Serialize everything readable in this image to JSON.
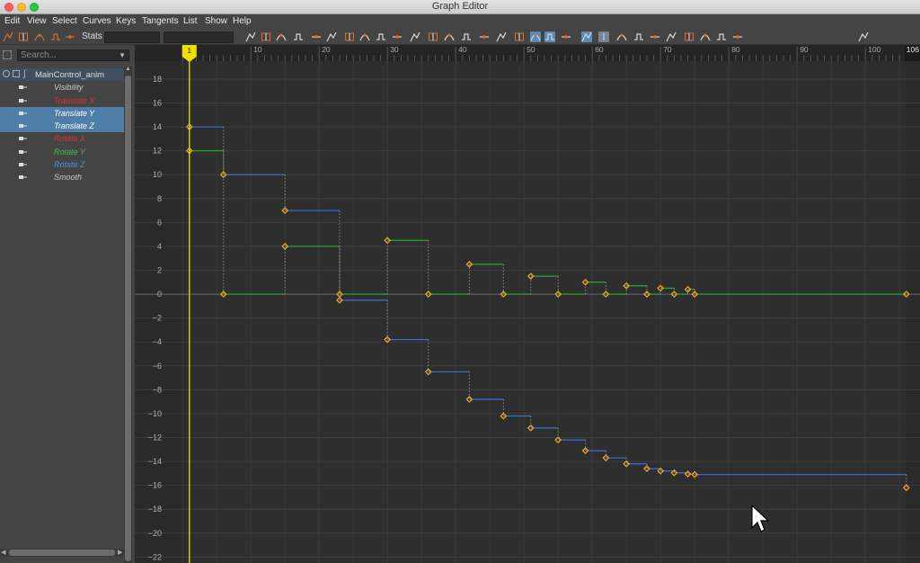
{
  "window": {
    "title": "Graph Editor"
  },
  "menu": [
    "Edit",
    "View",
    "Select",
    "Curves",
    "Keys",
    "Tangents",
    "List",
    "Show",
    "Help"
  ],
  "toolbar": {
    "stats_label": "Stats",
    "icons": [
      "move-key-icon",
      "insert-key-icon",
      "lattice-icon",
      "region-icon",
      "retime-icon",
      "frame-all-icon",
      "frame-selection-icon",
      "frame-playback-icon",
      "auto-tangent-icon",
      "spline-tangent-icon",
      "clamped-tangent-icon",
      "linear-tangent-icon",
      "flat-tangent-icon",
      "step-tangent-icon",
      "step-next-icon",
      "plateau-tangent-icon",
      "buffer-curve-snapshot-icon",
      "swap-buffer-icon",
      "break-tangents-icon",
      "unify-tangents-icon",
      "free-tangent-weight-icon",
      "lock-tangent-weight-icon",
      "isolate-curve-icon",
      "normalize-icon",
      "denormalize-icon",
      "stacked-view-icon",
      "absolute-view-icon",
      "infinity-icon",
      "pre-infinity-cycle-icon",
      "post-infinity-cycle-icon",
      "cycle-offset-icon",
      "oscillate-icon",
      "key-tick-icon",
      "dope-sheet-icon",
      "time-editor-icon",
      "trax-editor-icon"
    ]
  },
  "outliner": {
    "search_placeholder": "Search...",
    "root_label": "MainControl_anim",
    "attributes": [
      {
        "label": "Visibility",
        "color": "#c8c8c8",
        "selected": false
      },
      {
        "label": "Translate X",
        "color": "#e03030",
        "selected": false
      },
      {
        "label": "Translate Y",
        "color": "#ffffff",
        "selected": true
      },
      {
        "label": "Translate Z",
        "color": "#ffffff",
        "selected": true
      },
      {
        "label": "Rotate X",
        "color": "#e03030",
        "selected": false
      },
      {
        "label": "Rotate Y",
        "color": "#39c04a",
        "selected": false
      },
      {
        "label": "Rotate Z",
        "color": "#4a90e0",
        "selected": false
      },
      {
        "label": "Smooth",
        "color": "#c8c8c8",
        "selected": false
      }
    ]
  },
  "timeline": {
    "frame_labels": [
      "10",
      "20",
      "30",
      "40",
      "50",
      "60",
      "70",
      "80",
      "90",
      "100"
    ],
    "current_frame": "1",
    "end_frame": "106"
  },
  "colors": {
    "green_curve": "#1fae2d",
    "blue_curve": "#3a6fd8",
    "key": "#f0a020",
    "current_time": "#f0e000"
  },
  "chart_data": {
    "type": "line",
    "title": "",
    "xlabel": "",
    "ylabel": "",
    "xlim": [
      -7,
      108
    ],
    "ylim": [
      -22.5,
      19.5
    ],
    "y_ticks": [
      18,
      16,
      14,
      12,
      10,
      8,
      6,
      4,
      2,
      0,
      -2,
      -4,
      -6,
      -8,
      -10,
      -12,
      -14,
      -16,
      -18,
      -20,
      -22
    ],
    "x_ticks": [
      10,
      20,
      30,
      40,
      50,
      60,
      70,
      80,
      90,
      100
    ],
    "current_frame": 1,
    "step_tangents": true,
    "series": [
      {
        "color": "#1fae2d",
        "keys": [
          [
            1,
            12
          ],
          [
            6,
            0
          ],
          [
            15,
            4
          ],
          [
            23,
            0
          ],
          [
            30,
            4.5
          ],
          [
            36,
            0
          ],
          [
            42,
            2.5
          ],
          [
            47,
            0
          ],
          [
            51,
            1.5
          ],
          [
            55,
            0
          ],
          [
            59,
            1
          ],
          [
            62,
            0
          ],
          [
            65,
            0.7
          ],
          [
            68,
            0
          ],
          [
            70,
            0.5
          ],
          [
            72,
            0
          ],
          [
            74,
            0.4
          ],
          [
            75,
            0
          ],
          [
            106,
            0
          ]
        ]
      },
      {
        "color": "#3a6fd8",
        "keys": [
          [
            1,
            14
          ],
          [
            6,
            10
          ],
          [
            15,
            7
          ],
          [
            23,
            -0.5
          ],
          [
            30,
            -3.8
          ],
          [
            36,
            -6.5
          ],
          [
            42,
            -8.8
          ],
          [
            47,
            -10.2
          ],
          [
            51,
            -11.2
          ],
          [
            55,
            -12.2
          ],
          [
            59,
            -13.1
          ],
          [
            62,
            -13.7
          ],
          [
            65,
            -14.2
          ],
          [
            68,
            -14.6
          ],
          [
            70,
            -14.8
          ],
          [
            72,
            -14.95
          ],
          [
            74,
            -15.05
          ],
          [
            75,
            -15.1
          ],
          [
            106,
            -16.2
          ]
        ]
      }
    ]
  }
}
